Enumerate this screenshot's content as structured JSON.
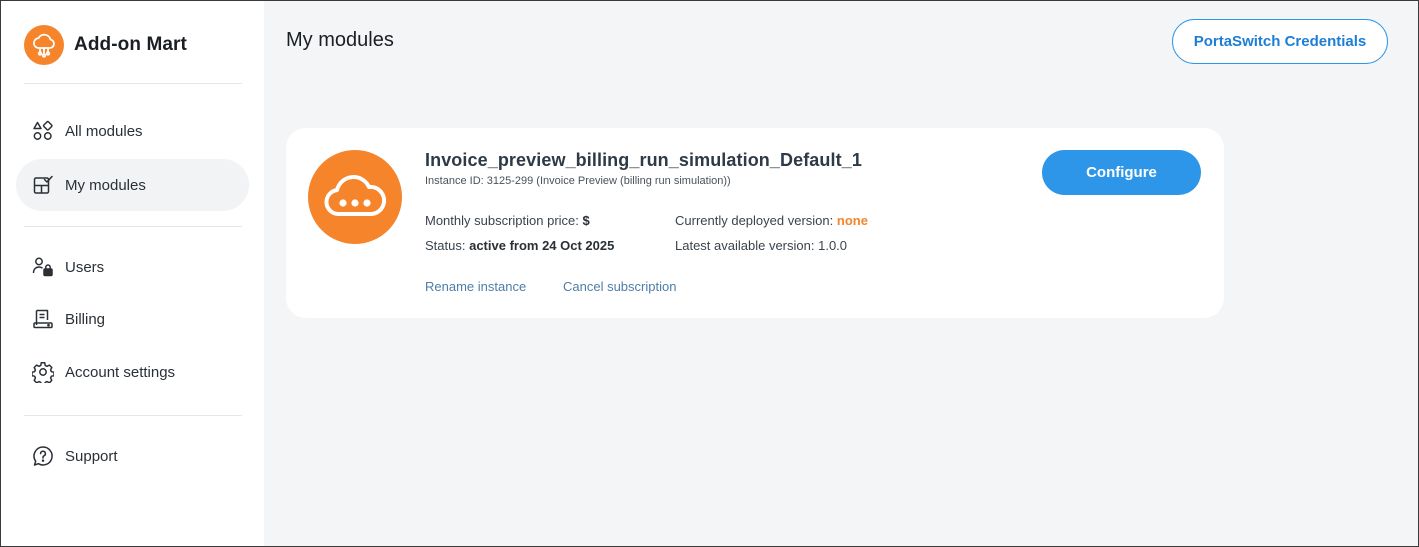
{
  "brand": {
    "name": "Add-on Mart",
    "logo_icon": "cloud-network-icon",
    "color": "#f5842a"
  },
  "sidebar": {
    "items": [
      {
        "label": "All modules",
        "icon": "shapes-icon"
      },
      {
        "label": "My modules",
        "icon": "checked-modules-icon",
        "active": true
      },
      {
        "label": "Users",
        "icon": "users-lock-icon"
      },
      {
        "label": "Billing",
        "icon": "receipt-icon"
      },
      {
        "label": "Account settings",
        "icon": "gear-icon"
      },
      {
        "label": "Support",
        "icon": "help-bubble-icon"
      }
    ]
  },
  "header": {
    "title": "My modules",
    "credentials_button": "PortaSwitch Credentials"
  },
  "module": {
    "name": "Invoice_preview_billing_run_simulation_Default_1",
    "instance_id": "Instance ID: 3125-299 (Invoice Preview (billing run simulation))",
    "price_label": "Monthly subscription price:",
    "price_value": "$",
    "status_label": "Status:",
    "status_value": "active from 24 Oct 2025",
    "deployed_label": "Currently deployed version:",
    "deployed_value": "none",
    "latest_label": "Latest available version:",
    "latest_value": "1.0.0",
    "rename_link": "Rename instance",
    "cancel_link": "Cancel subscription",
    "configure_button": "Configure",
    "icon": "cloud-dots-icon"
  },
  "colors": {
    "accent": "#2d96e8",
    "orange": "#f5842a",
    "main_bg": "#f4f5f7",
    "active_nav_bg": "#f2f3f4"
  }
}
